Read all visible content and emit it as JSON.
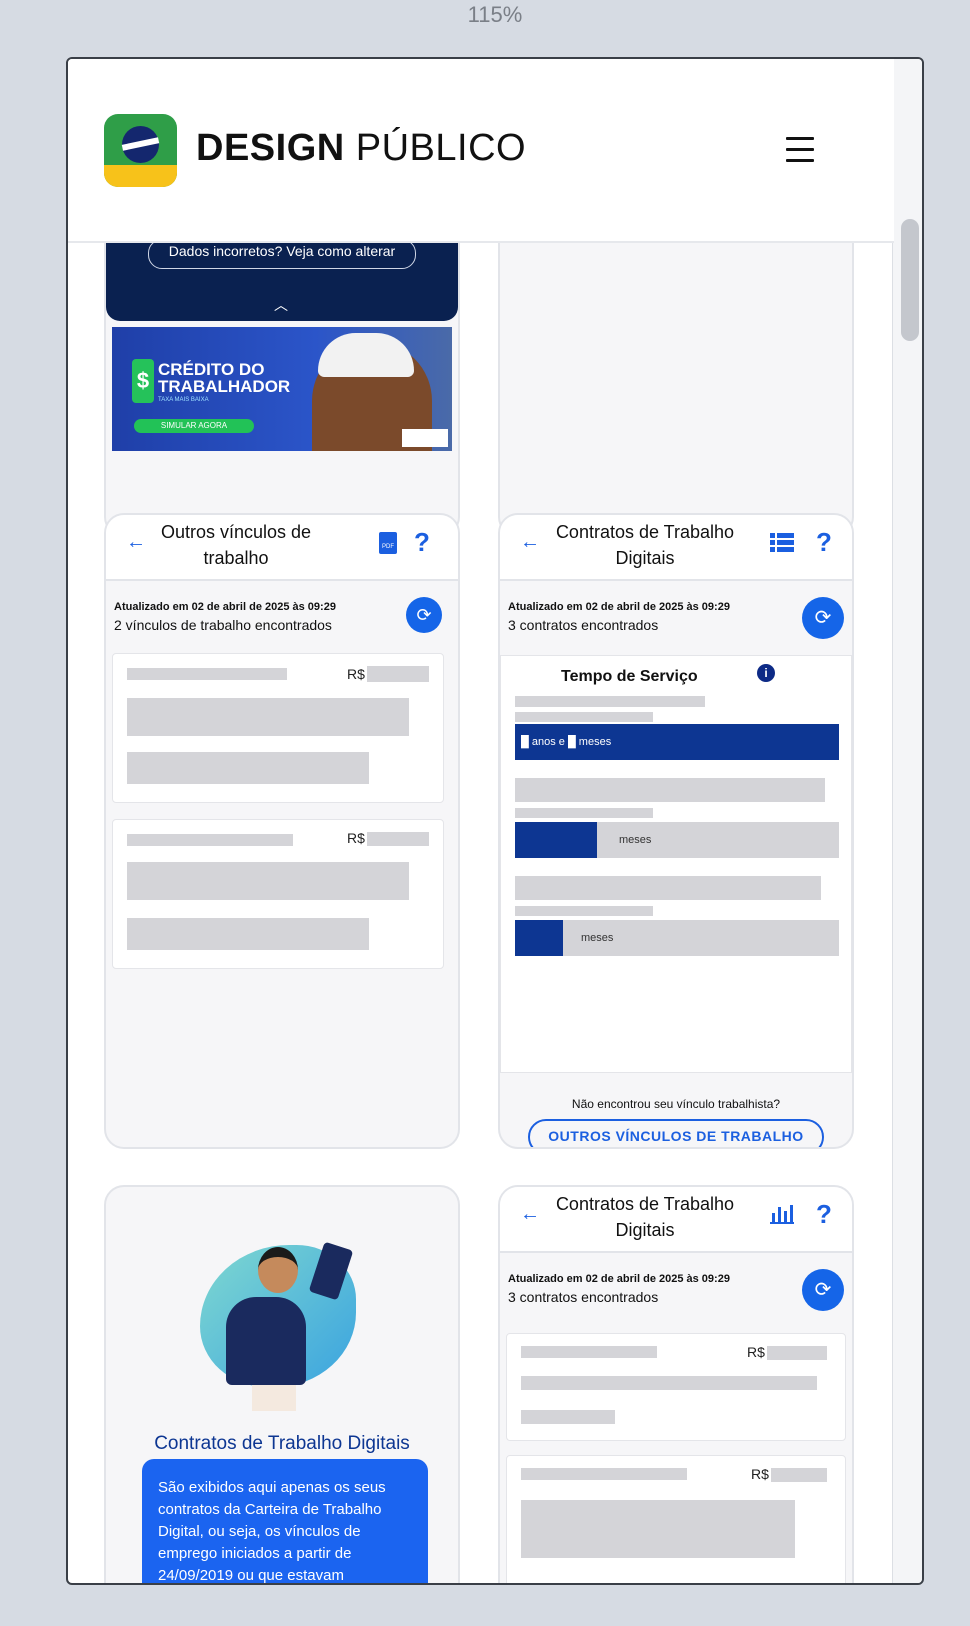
{
  "browser": {
    "zoom_label": "115%"
  },
  "header": {
    "brand_bold": "DESIGN",
    "brand_regular": "PÚBLICO",
    "menu_icon": "hamburger-icon"
  },
  "card1": {
    "dados_button": "Dados incorretos? Veja como alterar",
    "banner": {
      "line1": "CRÉDITO DO",
      "line2": "TRABALHADOR",
      "tagline": "TAXA MAIS BAIXA",
      "cta": "SIMULAR AGORA"
    }
  },
  "card3": {
    "title": "Outros vínculos de trabalho",
    "updated": "Atualizado em 02 de abril de 2025 às 09:29",
    "found": "2 vínculos de trabalho encontrados",
    "currency": "R$"
  },
  "card4": {
    "title": "Contratos de Trabalho Digitais",
    "updated": "Atualizado em 02 de abril de 2025 às 09:29",
    "found": "3 contratos encontrados",
    "section_title": "Tempo de Serviço",
    "bar1_label": "anos e",
    "bar1_label2": "meses",
    "bar2_label": "meses",
    "bar3_label": "meses",
    "footer_question": "Não encontrou seu vínculo trabalhista?",
    "footer_button": "OUTROS VÍNCULOS DE TRABALHO"
  },
  "card5": {
    "heading": "Contratos de Trabalho Digitais",
    "info_text": "São exibidos aqui apenas os seus contratos da Carteira de Trabalho Digital, ou seja, os vínculos de emprego iniciados a partir de 24/09/2019 ou que estavam"
  },
  "card6": {
    "title": "Contratos de Trabalho Digitais",
    "updated": "Atualizado em 02 de abril de 2025 às 09:29",
    "found": "3 contratos encontrados",
    "currency": "R$"
  }
}
